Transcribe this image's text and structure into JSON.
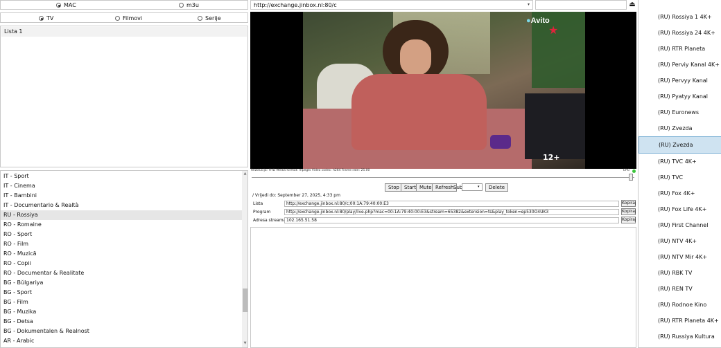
{
  "source_mode": {
    "mac_label": "MAC",
    "m3u_label": "m3u",
    "selected": "MAC"
  },
  "content_type": {
    "tv_label": "TV",
    "movies_label": "Filmovi",
    "series_label": "Serije",
    "selected": "TV"
  },
  "playlist_box": {
    "item": "Lista 1"
  },
  "url_bar": {
    "value": "http://exchange.jinbox.nl:80/c"
  },
  "categories": [
    "IT - Sport",
    "IT - Cinema",
    "IT - Bambini",
    "IT - Documentario & Realtà",
    "RU - Rossiya",
    "RO - Romaine",
    "RO - Sport",
    "RO - Film",
    "RO - Muzică",
    "RO - Copii",
    "RO - Documentar & Realitate",
    "BG - Bŭlgariya",
    "BG - Sport",
    "BG - Film",
    "BG - Muzika",
    "BG - Detsa",
    "BG - Dokumentalen & Realnost",
    "AR - Arabic"
  ],
  "selected_category": "RU - Rossiya",
  "video": {
    "brand": "Avito",
    "age_rating": "12+"
  },
  "media_info": {
    "text": "Rezolucija: FHD Media format: mpegts Video codec: h264 Frame rate: 25.00",
    "epg_label": "EPG"
  },
  "controls": {
    "stop": "Stop",
    "start": "Start",
    "mute": "Mute",
    "refresh": "Refresh",
    "sub_label": "Sub",
    "delete": "Delete"
  },
  "expiry": "/ Vrijedi do: September 27, 2025, 4:33 pm",
  "info_rows": [
    {
      "label": "Lista",
      "value": "http://exchange.jinbox.nl:80/c;00:1A:79:40:00:E3",
      "button": "Kopiraj"
    },
    {
      "label": "Program",
      "value": "http://exchange.jinbox.nl:80/play/live.php?mac=00:1A:79:40:00:E3&stream=65382&extension=ts&play_token=ep530O4UK3",
      "button": "Kopiraj"
    },
    {
      "label": "Adresa streama",
      "value": "102.165.51.58",
      "button": "Kopiraj"
    }
  ],
  "channels": [
    "(RU) Rossiya 1 4K+",
    "(RU) Rossiya 24 4K+",
    "(RU) RTR Planeta",
    "(RU) Perviy Kanal 4K+",
    "(RU) Pervyy Kanal",
    "(RU) Pyatyy Kanal",
    "(RU) Euronews",
    "(RU) Zvezda",
    "(RU) Zvezda",
    "(RU) TVC 4K+",
    "(RU) TVC",
    "(RU) Fox 4K+",
    "(RU) Fox Life 4K+",
    "(RU) First Channel",
    "(RU) NTV 4K+",
    "(RU) NTV Mir 4K+",
    "(RU) RBK TV",
    "(RU) REN TV",
    "(RU) Rodnoe Kino",
    "(RU) RTR Planeta 4K+",
    "(RU) Russiya Kultura"
  ],
  "selected_channel_index": 8,
  "colors": {
    "selection": "#cfe3f1",
    "epg_dot": "#3cc43c",
    "video_bg": "#000000"
  }
}
